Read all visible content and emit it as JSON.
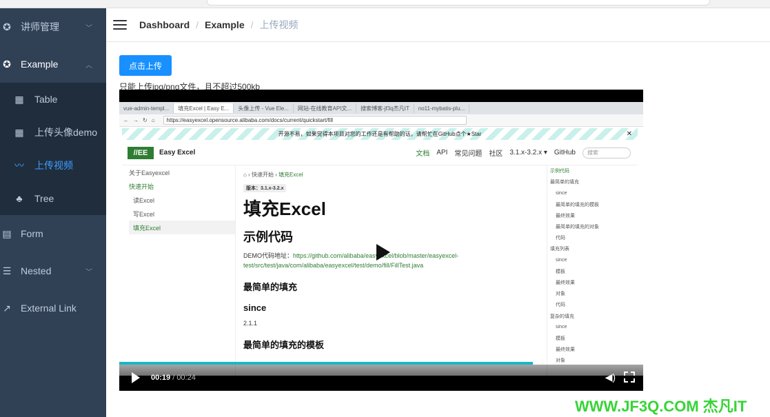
{
  "sidebar": {
    "items": [
      {
        "label": "讲师管理",
        "icon": "gear-icon",
        "arrow": "chevron-down"
      },
      {
        "label": "Example",
        "icon": "gear-icon",
        "arrow": "chevron-up"
      },
      {
        "label": "Form",
        "icon": "form-icon"
      },
      {
        "label": "Nested",
        "icon": "nested-list-icon",
        "arrow": "chevron-down"
      },
      {
        "label": "External Link",
        "icon": "external-link-icon"
      }
    ],
    "submenu": [
      {
        "label": "Table",
        "icon": "table-icon"
      },
      {
        "label": "上传头像demo",
        "icon": "table-icon"
      },
      {
        "label": "上传视频",
        "icon": "video-icon"
      },
      {
        "label": "Tree",
        "icon": "tree-icon"
      }
    ]
  },
  "breadcrumb": [
    "Dashboard",
    "Example",
    "上传视频"
  ],
  "upload": {
    "button_label": "点击上传",
    "tip": "只能上传jpg/png文件，且不超过500kb"
  },
  "video": {
    "current_time": "00:19",
    "duration": "/ 00:24",
    "progress": 0.79,
    "browser": {
      "tabs": [
        "vue-admin-templ...",
        "填充Excel | Easy E...",
        "头像上传 - Vue Ele...",
        "网站-在线教育API文...",
        "搜索博客-jf3q杰凡IT",
        "no11-mybatis-plu..."
      ],
      "url": "https://easyexcel.opensource.alibaba.com/docs/current/quickstart/fill",
      "banner": "开源不易，如果觉得本项目对您的工作还是有帮助的话，请帮忙在GitHub点个★Star",
      "logo": "//EE",
      "site_name": "Easy Excel",
      "nav": [
        "文档",
        "API",
        "常见问题",
        "社区",
        "3.1.x-3.2.x ▾",
        "GitHub",
        "搜索"
      ],
      "left_nav": [
        "关于Easyexcel",
        "快速开始",
        "读Excel",
        "写Excel",
        "填充Excel"
      ],
      "crumbs": [
        "快速开始",
        "填充Excel"
      ],
      "version": "版本：3.1.x-3.2.x",
      "h1": "填充Excel",
      "h2": "示例代码",
      "demo_label": "DEMO代码地址：",
      "demo_link": "https://github.com/alibaba/easyexcel/blob/master/easyexcel-test/src/test/java/com/alibaba/easyexcel/test/demo/fill/FillTest.java",
      "h3a": "最简单的填充",
      "since_label": "since",
      "since_value": "2.1.1",
      "h3b": "最简单的填充的模板",
      "toc": [
        "示例代码",
        "最简单的填充",
        "since",
        "最简单的填充的模板",
        "最终效果",
        "最简单的填充的对象",
        "代码",
        "填充列表",
        "since",
        "模板",
        "最终效果",
        "对象",
        "代码",
        "复杂的填充",
        "since",
        "模板",
        "最终效果",
        "对象"
      ]
    }
  },
  "watermark": "WWW.JF3Q.COM 杰凡IT"
}
